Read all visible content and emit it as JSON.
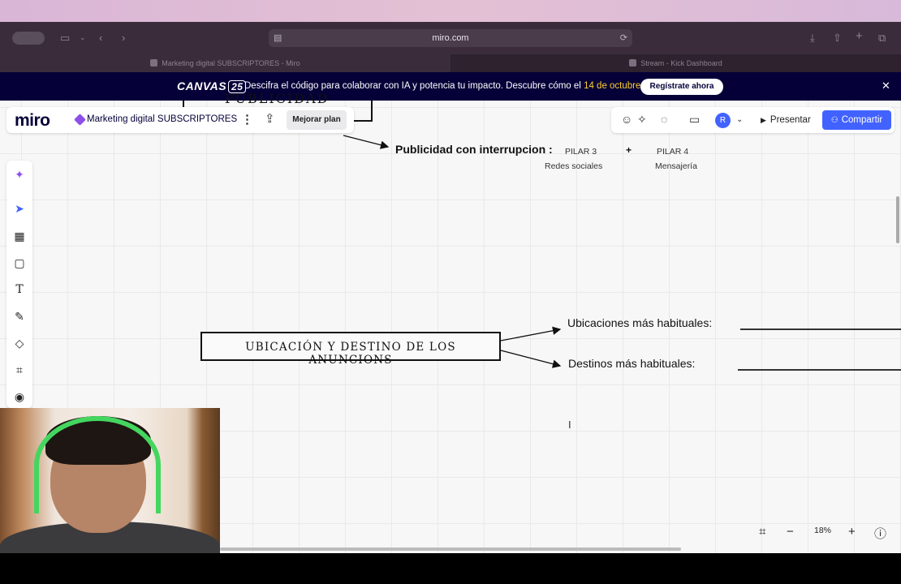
{
  "browser": {
    "url": "miro.com",
    "tabs": [
      {
        "label": "Marketing digital SUBSCRIPTORES - Miro",
        "active": true
      },
      {
        "label": "Stream - Kick Dashboard",
        "active": false
      }
    ]
  },
  "banner": {
    "logo": "CANVAS",
    "logo_num": "25",
    "text": "Descifra el código para colaborar con IA y potencia tu impacto. Descubre cómo el",
    "date": "14 de octubre.",
    "cta": "Regístrate ahora"
  },
  "header": {
    "logo": "miro",
    "board_name": "Marketing digital SUBSCRIPTORES",
    "upgrade": "Mejorar plan",
    "avatar_initial": "R",
    "present": "Presentar",
    "share": "Compartir"
  },
  "canvas": {
    "top_box_text": "PUBLICIDAD",
    "pub_title": "Publicidad con interrupcion :",
    "pillar3_title": "PILAR 3",
    "pillar3_sub": "Redes sociales",
    "pillar4_title": "PILAR 4",
    "pillar4_sub": "Mensajería",
    "plus": "+",
    "main_box": "UBICACIÓN Y DESTINO DE LOS ANUNCIONS",
    "label1": "Ubicaciones más habituales:",
    "label2": "Destinos más habituales:"
  },
  "zoom": {
    "value": "18%"
  },
  "colors": {
    "accent": "#4262ff",
    "banner_bg": "#050038",
    "date": "#ffd02f"
  }
}
